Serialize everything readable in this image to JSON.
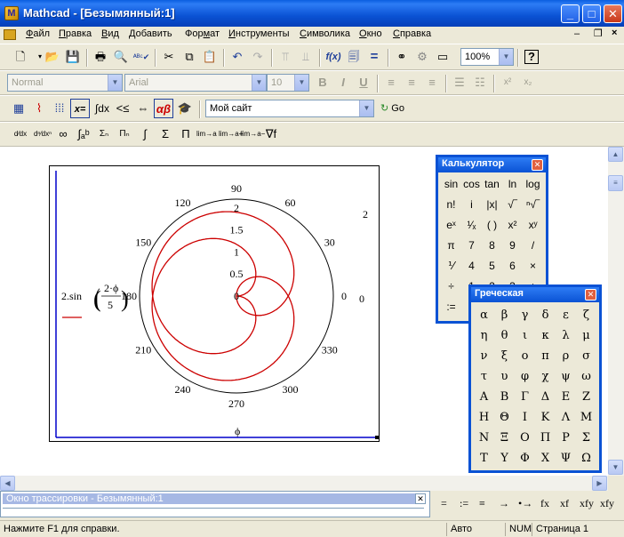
{
  "window": {
    "title": "Mathcad - [Безымянный:1]",
    "app_icon": "M"
  },
  "menu": [
    {
      "pre": "",
      "u": "Ф",
      "post": "айл"
    },
    {
      "pre": "",
      "u": "П",
      "post": "равка"
    },
    {
      "pre": "",
      "u": "В",
      "post": "ид"
    },
    {
      "pre": "",
      "u": "Д",
      "post": "обавить"
    },
    {
      "pre": "Фор",
      "u": "м",
      "post": "ат"
    },
    {
      "pre": "",
      "u": "И",
      "post": "нструменты"
    },
    {
      "pre": "",
      "u": "С",
      "post": "имволика"
    },
    {
      "pre": "",
      "u": "О",
      "post": "кно"
    },
    {
      "pre": "",
      "u": "С",
      "post": "правка"
    }
  ],
  "toolbar": {
    "zoom": "100%"
  },
  "format_bar": {
    "style": "Normal",
    "font": "Arial",
    "size": "10",
    "bold": "B",
    "italic": "I",
    "underline": "U"
  },
  "resources": {
    "combo": "Мой сайт",
    "go": "Go"
  },
  "plot": {
    "angles": [
      "90",
      "60",
      "30",
      "0",
      "330",
      "300",
      "270",
      "240",
      "210",
      "180",
      "150",
      "120"
    ],
    "radial_ticks": [
      "2",
      "1.5",
      "1",
      "0.5",
      "0"
    ],
    "outer_right": "2",
    "outer_right2": "0",
    "y_expr_left": "2.sin",
    "y_expr_num": "2·ϕ",
    "y_expr_den": "5",
    "x_label": "ϕ"
  },
  "calculator": {
    "title": "Калькулятор",
    "keys": [
      "sin",
      "cos",
      "tan",
      "ln",
      "log",
      "n!",
      "i",
      "|x|",
      "√‾",
      "ⁿ√‾",
      "eˣ",
      "¹⁄ₓ",
      "( )",
      "x²",
      "xʸ",
      "π",
      "7",
      "8",
      "9",
      "/",
      "⅟",
      "4",
      "5",
      "6",
      "×",
      "÷",
      "1",
      "2",
      "3",
      "+",
      ":=",
      "",
      "",
      "",
      ""
    ]
  },
  "greek": {
    "title": "Греческая",
    "letters": [
      "α",
      "β",
      "γ",
      "δ",
      "ε",
      "ζ",
      "η",
      "θ",
      "ι",
      "κ",
      "λ",
      "μ",
      "ν",
      "ξ",
      "ο",
      "π",
      "ρ",
      "σ",
      "τ",
      "υ",
      "φ",
      "χ",
      "ψ",
      "ω",
      "Α",
      "Β",
      "Γ",
      "Δ",
      "Ε",
      "Ζ",
      "Η",
      "Θ",
      "Ι",
      "Κ",
      "Λ",
      "Μ",
      "Ν",
      "Ξ",
      "Ο",
      "Π",
      "Ρ",
      "Σ",
      "Τ",
      "Υ",
      "Φ",
      "Χ",
      "Ψ",
      "Ω"
    ]
  },
  "trace": {
    "title": "Окно трассировки - Безымянный:1"
  },
  "eval_ops": [
    "=",
    ":=",
    "≡",
    "→",
    "•→",
    "fx",
    "xf",
    "xfy",
    "xfy"
  ],
  "status": {
    "help": "Нажмите F1 для справки.",
    "mode": "Авто",
    "num": "NUM",
    "page": "Страница 1"
  },
  "colors": {
    "title_blue": "#0a52d4",
    "curve": "#cc0000",
    "axis_blue": "#0000cc"
  }
}
